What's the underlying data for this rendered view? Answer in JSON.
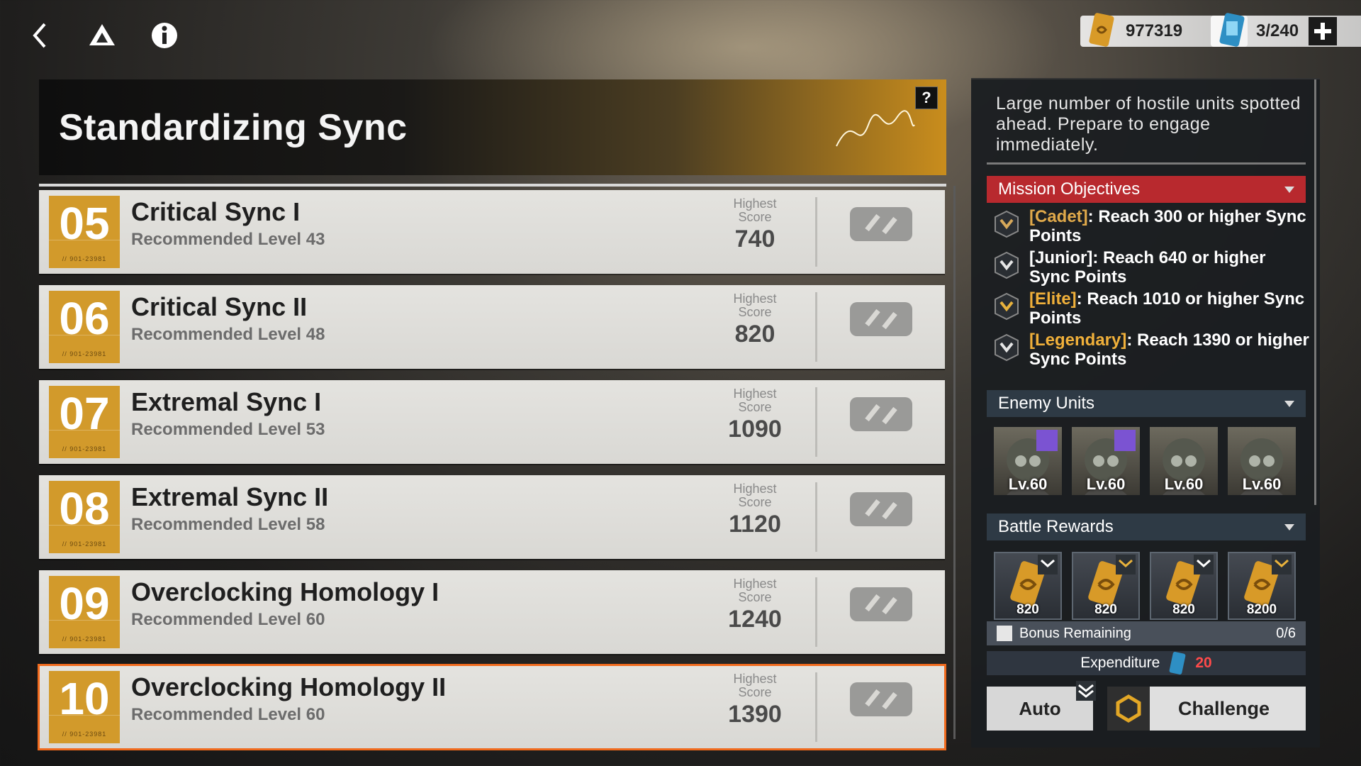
{
  "topbar": {
    "back_icon": "chevron-left-icon",
    "home_icon": "triangle-logo-icon",
    "info_icon": "info-icon",
    "credits": "977319",
    "stamina": "3/240",
    "add_icon": "plus-icon"
  },
  "banner": {
    "title": "Standardizing Sync",
    "help": "?"
  },
  "stages": [
    {
      "num": "05",
      "code": "// 901-23981",
      "name": "Critical Sync I",
      "rec": "Recommended Level 43",
      "score_label": "Highest Score",
      "score": "740",
      "selected": false
    },
    {
      "num": "06",
      "code": "// 901-23981",
      "name": "Critical Sync II",
      "rec": "Recommended Level 48",
      "score_label": "Highest Score",
      "score": "820",
      "selected": false
    },
    {
      "num": "07",
      "code": "// 901-23981",
      "name": "Extremal Sync I",
      "rec": "Recommended Level 53",
      "score_label": "Highest Score",
      "score": "1090",
      "selected": false
    },
    {
      "num": "08",
      "code": "// 901-23981",
      "name": "Extremal Sync II",
      "rec": "Recommended Level 58",
      "score_label": "Highest Score",
      "score": "1120",
      "selected": false
    },
    {
      "num": "09",
      "code": "// 901-23981",
      "name": "Overclocking Homology I",
      "rec": "Recommended Level 60",
      "score_label": "Highest Score",
      "score": "1240",
      "selected": false
    },
    {
      "num": "10",
      "code": "// 901-23981",
      "name": "Overclocking Homology II",
      "rec": "Recommended Level 60",
      "score_label": "Highest Score",
      "score": "1390",
      "selected": true
    }
  ],
  "panel": {
    "description": "Large number of hostile units spotted ahead. Prepare to engage immediately.",
    "objectives_title": "Mission Objectives",
    "objectives": [
      {
        "tier": "[Cadet]",
        "text": ": Reach 300 or higher Sync Points",
        "tier_color": "#e0a94a"
      },
      {
        "tier": "[Junior]",
        "text": ": Reach 640 or higher Sync Points",
        "tier_color": "#ffffff"
      },
      {
        "tier": "[Elite]",
        "text": ": Reach 1010 or higher Sync Points",
        "tier_color": "#f0b03a"
      },
      {
        "tier": "[Legendary]",
        "text": ": Reach 1390 or higher Sync Points",
        "tier_color": "#f0b03a"
      }
    ],
    "enemy_title": "Enemy Units",
    "enemies": [
      {
        "level": "Lv.60",
        "elite": true
      },
      {
        "level": "Lv.60",
        "elite": true
      },
      {
        "level": "Lv.60",
        "elite": false
      },
      {
        "level": "Lv.60",
        "elite": false
      }
    ],
    "rewards_title": "Battle Rewards",
    "rewards": [
      {
        "amount": "820",
        "tier": "legendary"
      },
      {
        "amount": "820",
        "tier": "elite"
      },
      {
        "amount": "820",
        "tier": "junior"
      },
      {
        "amount": "8200",
        "tier": "cadet"
      }
    ],
    "bonus_label": "Bonus Remaining",
    "bonus_value": "0/6",
    "expenditure_label": "Expenditure",
    "expenditure_cost": "20",
    "auto_label": "Auto",
    "challenge_label": "Challenge"
  },
  "colors": {
    "accent_orange": "#f06a1d",
    "stage_gold": "#d29a2b",
    "objective_red": "#b8292e"
  }
}
